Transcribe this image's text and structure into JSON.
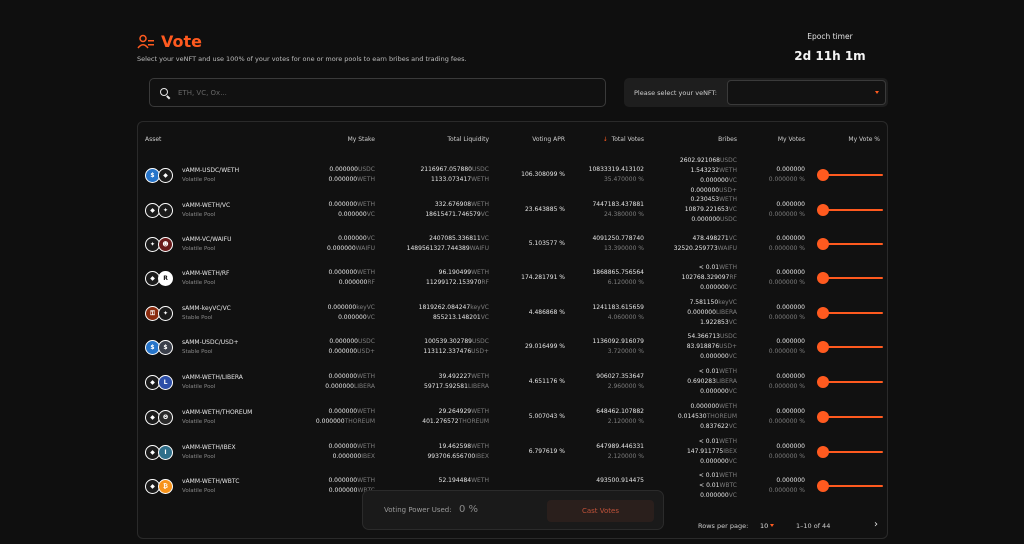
{
  "page": {
    "title": "Vote",
    "subtitle": "Select your veNFT and use 100% of your votes for one or more pools to earn bribes and trading fees.",
    "accent": "#ff5a1f"
  },
  "epoch": {
    "label": "Epoch timer",
    "value": "2d 11h 1m"
  },
  "search": {
    "placeholder": "ETH, VC, Ox..."
  },
  "venft": {
    "label": "Please select your veNFT:",
    "value": ""
  },
  "table": {
    "headers": {
      "asset": "Asset",
      "stake": "My Stake",
      "liquidity": "Total Liquidity",
      "apr": "Voting APR",
      "total_votes": "Total Votes",
      "bribes": "Bribes",
      "my_votes": "My Votes",
      "my_vote_pct": "My Vote %"
    },
    "rows": [
      {
        "name": "vAMM-USDC/WETH",
        "type": "Volatile Pool",
        "icon1": "usdc-icon",
        "icon2": "weth-icon",
        "stake": [
          {
            "v": "0.000000",
            "u": "USDC"
          },
          {
            "v": "0.000000",
            "u": "WETH"
          }
        ],
        "liquidity": [
          {
            "v": "2116967.057880",
            "u": "USDC"
          },
          {
            "v": "1133.073417",
            "u": "WETH"
          }
        ],
        "apr": "106.308099 %",
        "total_votes": "10833319.413102",
        "votes_pct": "35.470000 %",
        "bribes": [
          {
            "v": "2602.921068",
            "u": "USDC"
          },
          {
            "v": "1.543232",
            "u": "WETH"
          },
          {
            "v": "0.000000",
            "u": "VC"
          },
          {
            "v": "0.000000",
            "u": "USD+"
          }
        ],
        "my_votes": "0.000000",
        "my_votes_pct": "0.000000 %",
        "my_vote_value": 0
      },
      {
        "name": "vAMM-WETH/VC",
        "type": "Volatile Pool",
        "icon1": "weth-icon",
        "icon2": "vc-icon",
        "stake": [
          {
            "v": "0.000000",
            "u": "WETH"
          },
          {
            "v": "0.000000",
            "u": "VC"
          }
        ],
        "liquidity": [
          {
            "v": "332.676908",
            "u": "WETH"
          },
          {
            "v": "18615471.746579",
            "u": "VC"
          }
        ],
        "apr": "23.643885 %",
        "total_votes": "7447183.437881",
        "votes_pct": "24.380000 %",
        "bribes": [
          {
            "v": "0.230453",
            "u": "WETH"
          },
          {
            "v": "10879.221653",
            "u": "VC"
          },
          {
            "v": "0.000000",
            "u": "USDC"
          }
        ],
        "my_votes": "0.000000",
        "my_votes_pct": "0.000000 %",
        "my_vote_value": 0
      },
      {
        "name": "vAMM-VC/WAIFU",
        "type": "Volatile Pool",
        "icon1": "vc-icon",
        "icon2": "waifu-icon",
        "stake": [
          {
            "v": "0.000000",
            "u": "VC"
          },
          {
            "v": "0.000000",
            "u": "WAIFU"
          }
        ],
        "liquidity": [
          {
            "v": "2407085.336811",
            "u": "VC"
          },
          {
            "v": "1489561327.744389",
            "u": "WAIFU"
          }
        ],
        "apr": "5.103577 %",
        "total_votes": "4091250.778740",
        "votes_pct": "13.390000 %",
        "bribes": [
          {
            "v": "478.498271",
            "u": "VC"
          },
          {
            "v": "32520.259773",
            "u": "WAIFU"
          }
        ],
        "my_votes": "0.000000",
        "my_votes_pct": "0.000000 %",
        "my_vote_value": 0
      },
      {
        "name": "vAMM-WETH/RF",
        "type": "Volatile Pool",
        "icon1": "weth-icon",
        "icon2": "rf-icon",
        "stake": [
          {
            "v": "0.000000",
            "u": "WETH"
          },
          {
            "v": "0.000000",
            "u": "RF"
          }
        ],
        "liquidity": [
          {
            "v": "96.190499",
            "u": "WETH"
          },
          {
            "v": "11299172.153970",
            "u": "RF"
          }
        ],
        "apr": "174.281791 %",
        "total_votes": "1868865.756564",
        "votes_pct": "6.120000 %",
        "bribes": [
          {
            "v": "< 0.01",
            "u": "WETH"
          },
          {
            "v": "102768.329097",
            "u": "RF"
          },
          {
            "v": "0.000000",
            "u": "VC"
          }
        ],
        "my_votes": "0.000000",
        "my_votes_pct": "0.000000 %",
        "my_vote_value": 0
      },
      {
        "name": "sAMM-keyVC/VC",
        "type": "Stable Pool",
        "icon1": "keyvc-icon",
        "icon2": "vc-icon",
        "stake": [
          {
            "v": "0.000000",
            "u": "keyVC"
          },
          {
            "v": "0.000000",
            "u": "VC"
          }
        ],
        "liquidity": [
          {
            "v": "1819262.084247",
            "u": "keyVC"
          },
          {
            "v": "855213.148201",
            "u": "VC"
          }
        ],
        "apr": "4.486868 %",
        "total_votes": "1241183.615659",
        "votes_pct": "4.060000 %",
        "bribes": [
          {
            "v": "7.581150",
            "u": "keyVC"
          },
          {
            "v": "0.000000",
            "u": "LIBERA"
          },
          {
            "v": "1.922853",
            "u": "VC"
          }
        ],
        "my_votes": "0.000000",
        "my_votes_pct": "0.000000 %",
        "my_vote_value": 0
      },
      {
        "name": "sAMM-USDC/USD+",
        "type": "Stable Pool",
        "icon1": "usdc-icon",
        "icon2": "usdplus-icon",
        "stake": [
          {
            "v": "0.000000",
            "u": "USDC"
          },
          {
            "v": "0.000000",
            "u": "USD+"
          }
        ],
        "liquidity": [
          {
            "v": "100539.302789",
            "u": "USDC"
          },
          {
            "v": "113112.337476",
            "u": "USD+"
          }
        ],
        "apr": "29.016499 %",
        "total_votes": "1136092.916079",
        "votes_pct": "3.720000 %",
        "bribes": [
          {
            "v": "54.366713",
            "u": "USDC"
          },
          {
            "v": "83.918876",
            "u": "USD+"
          },
          {
            "v": "0.000000",
            "u": "VC"
          }
        ],
        "my_votes": "0.000000",
        "my_votes_pct": "0.000000 %",
        "my_vote_value": 0
      },
      {
        "name": "vAMM-WETH/LIBERA",
        "type": "Volatile Pool",
        "icon1": "weth-icon",
        "icon2": "libera-icon",
        "stake": [
          {
            "v": "0.000000",
            "u": "WETH"
          },
          {
            "v": "0.000000",
            "u": "LIBERA"
          }
        ],
        "liquidity": [
          {
            "v": "39.492227",
            "u": "WETH"
          },
          {
            "v": "59717.592581",
            "u": "LIBERA"
          }
        ],
        "apr": "4.651176 %",
        "total_votes": "906027.353647",
        "votes_pct": "2.960000 %",
        "bribes": [
          {
            "v": "< 0.01",
            "u": "WETH"
          },
          {
            "v": "0.690283",
            "u": "LIBERA"
          },
          {
            "v": "0.000000",
            "u": "VC"
          }
        ],
        "my_votes": "0.000000",
        "my_votes_pct": "0.000000 %",
        "my_vote_value": 0
      },
      {
        "name": "vAMM-WETH/THOREUM",
        "type": "Volatile Pool",
        "icon1": "weth-icon",
        "icon2": "thoreum-icon",
        "stake": [
          {
            "v": "0.000000",
            "u": "WETH"
          },
          {
            "v": "0.000000",
            "u": "THOREUM"
          }
        ],
        "liquidity": [
          {
            "v": "29.264929",
            "u": "WETH"
          },
          {
            "v": "401.276572",
            "u": "THOREUM"
          }
        ],
        "apr": "5.007043 %",
        "total_votes": "648462.107882",
        "votes_pct": "2.120000 %",
        "bribes": [
          {
            "v": "0.000000",
            "u": "WETH"
          },
          {
            "v": "0.014530",
            "u": "THOREUM"
          },
          {
            "v": "0.837622",
            "u": "VC"
          }
        ],
        "my_votes": "0.000000",
        "my_votes_pct": "0.000000 %",
        "my_vote_value": 0
      },
      {
        "name": "vAMM-WETH/IBEX",
        "type": "Volatile Pool",
        "icon1": "weth-icon",
        "icon2": "ibex-icon",
        "stake": [
          {
            "v": "0.000000",
            "u": "WETH"
          },
          {
            "v": "0.000000",
            "u": "IBEX"
          }
        ],
        "liquidity": [
          {
            "v": "19.462598",
            "u": "WETH"
          },
          {
            "v": "993706.656700",
            "u": "IBEX"
          }
        ],
        "apr": "6.797619 %",
        "total_votes": "647989.446331",
        "votes_pct": "2.120000 %",
        "bribes": [
          {
            "v": "< 0.01",
            "u": "WETH"
          },
          {
            "v": "147.911775",
            "u": "IBEX"
          },
          {
            "v": "0.000000",
            "u": "VC"
          }
        ],
        "my_votes": "0.000000",
        "my_votes_pct": "0.000000 %",
        "my_vote_value": 0
      },
      {
        "name": "vAMM-WETH/WBTC",
        "type": "Volatile Pool",
        "icon1": "weth-icon",
        "icon2": "wbtc-icon",
        "stake": [
          {
            "v": "0.000000",
            "u": "WETH"
          },
          {
            "v": "0.000000",
            "u": "WBTC"
          }
        ],
        "liquidity": [
          {
            "v": "52.194484",
            "u": "WETH"
          },
          {
            "v": "",
            "u": ""
          }
        ],
        "apr": "",
        "total_votes": "493500.914475",
        "votes_pct": "",
        "bribes": [
          {
            "v": "< 0.01",
            "u": "WETH"
          },
          {
            "v": "< 0.01",
            "u": "WBTC"
          },
          {
            "v": "0.000000",
            "u": "VC"
          }
        ],
        "my_votes": "0.000000",
        "my_votes_pct": "0.000000 %",
        "my_vote_value": 0
      }
    ]
  },
  "pager": {
    "label": "Rows per page:",
    "size": "10",
    "range": "1–10 of 44",
    "next": "›"
  },
  "voting": {
    "label": "Voting Power Used:",
    "value": "0 %",
    "cast_label": "Cast Votes"
  },
  "colors": {
    "accent": "#ff5a1f",
    "bg": "#0f0f0f",
    "usdc": "#2775ca",
    "weth": "#1b1b1b",
    "wbtc": "#f7931a"
  }
}
